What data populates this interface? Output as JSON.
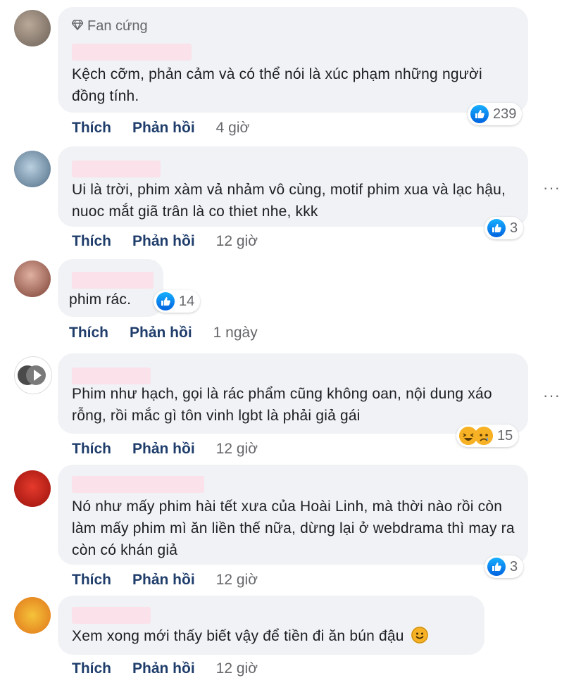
{
  "labels": {
    "like": "Thích",
    "reply": "Phản hồi"
  },
  "comments": [
    {
      "badge": "Fan cứng",
      "text": "Kệch cỡm, phản cảm và có thể nói là xúc phạm những người đồng tính.",
      "reaction_count": "239",
      "time": "4 giờ",
      "avatar_color": "#8a7d70"
    },
    {
      "text": "Ui là trời, phim xàm vả nhảm vô cùng, motif phim xua và lạc hậu, nuoc mắt giã trân là co thiet nhe, kkk",
      "reaction_count": "3",
      "time": "12 giờ",
      "avatar_color": "#6d8ba6"
    },
    {
      "text": "phim rác.",
      "reaction_count": "14",
      "time": "1 ngày",
      "avatar_color": "#a06a5a"
    },
    {
      "text": "Phim như hạch, gọi là rác phẩm cũng không oan, nội dung xáo rỗng, rồi mắc gì tôn vinh lgbt là phải giả gái",
      "reaction_count": "15",
      "time": "12 giờ",
      "avatar_color": "#555555"
    },
    {
      "text": "Nó như mấy phim hài tết xưa của Hoài Linh, mà thời nào rồi còn làm mấy phim mì ăn liền thế nữa, dừng lại ở webdrama thì may ra còn có khán giả",
      "reaction_count": "3",
      "time": "12 giờ",
      "avatar_color": "#d42a20"
    },
    {
      "text": "Xem xong mới thấy biết vậy để tiền đi ăn bún đậu",
      "time": "12 giờ",
      "avatar_color": "#f0a020"
    }
  ],
  "more_label": "···"
}
